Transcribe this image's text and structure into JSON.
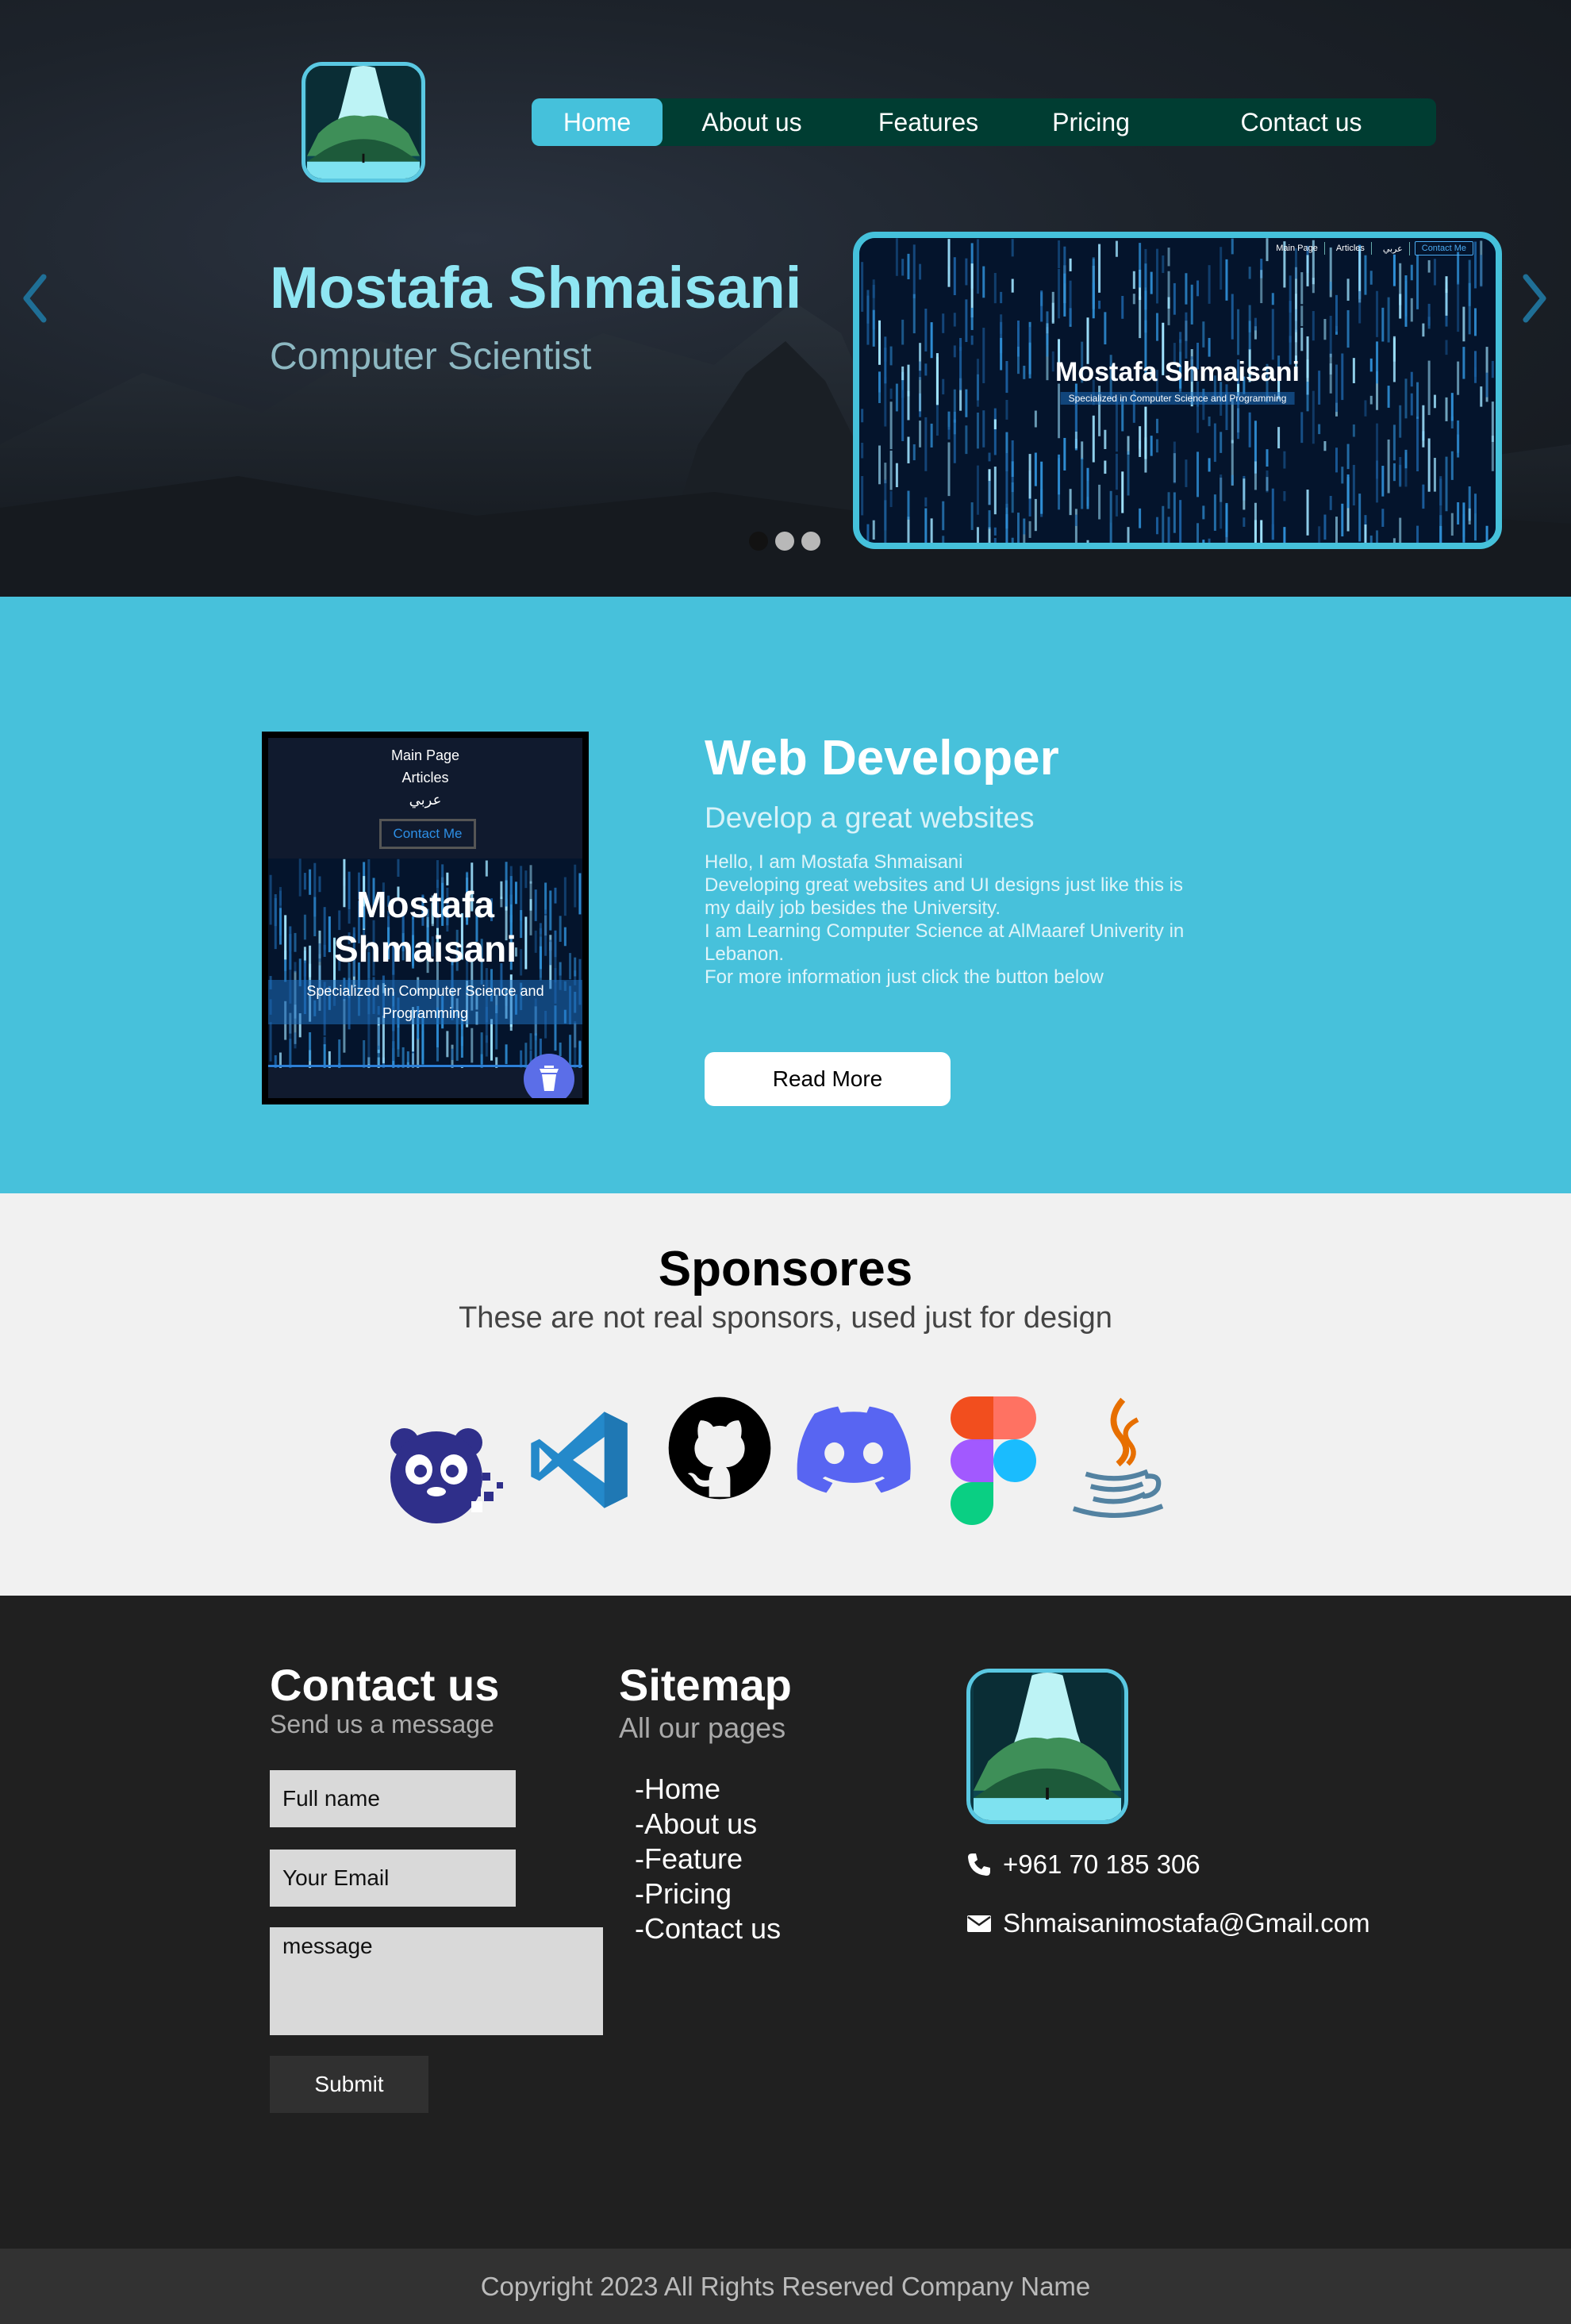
{
  "nav": {
    "items": [
      {
        "label": "Home",
        "active": true
      },
      {
        "label": "About us",
        "active": false
      },
      {
        "label": "Features",
        "active": false
      },
      {
        "label": "Pricing",
        "active": false
      },
      {
        "label": "Contact us",
        "active": false
      }
    ]
  },
  "hero": {
    "title": "Mostafa Shmaisani",
    "subtitle": "Computer Scientist",
    "preview": {
      "nav": [
        "Main Page",
        "Articles",
        "عربي",
        "Contact Me"
      ],
      "title": "Mostafa Shmaisani",
      "subtitle": "Specialized in Computer Science and Programming"
    },
    "slides_total": 3,
    "active_slide": 1
  },
  "webdev": {
    "phone": {
      "links": [
        "Main Page",
        "Articles",
        "عربي"
      ],
      "contact": "Contact Me",
      "title": "Mostafa Shmaisani",
      "subtitle": "Specialized in Computer Science and Programming"
    },
    "title": "Web Developer",
    "subtitle": "Develop a great websites",
    "body": [
      "Hello, I am Mostafa Shmaisani",
      "Developing great websites and UI designs just like this is my daily job besides the University.",
      "I am Learning Computer Science at AlMaaref Univerity in Lebanon.",
      "For more information just click the button below"
    ],
    "button": "Read More"
  },
  "sponsors": {
    "title": "Sponsores",
    "subtitle": "These are not real sponsors, used just for design",
    "logos": [
      "panda-icon",
      "vscode-icon",
      "github-icon",
      "discord-icon",
      "figma-icon",
      "java-icon"
    ]
  },
  "footer": {
    "contact": {
      "title": "Contact us",
      "subtitle": "Send us a message",
      "name_placeholder": "Full name",
      "email_placeholder": "Your Email",
      "message_placeholder": "message",
      "submit": "Submit"
    },
    "sitemap": {
      "title": "Sitemap",
      "subtitle": "All our pages",
      "links": [
        "-Home",
        "-About us",
        "-Feature",
        "-Pricing",
        "-Contact us"
      ]
    },
    "phone": "+961 70 185 306",
    "email": "Shmaisanimostafa@Gmail.com"
  },
  "copyright": "Copyright 2023 All Rights Reserved Company Name",
  "colors": {
    "accent": "#47c1db",
    "nav_bg": "#003d32",
    "hero_title": "#8fe6f3",
    "footer_bg": "#202020",
    "sponsors_bg": "#f1f1f1"
  }
}
